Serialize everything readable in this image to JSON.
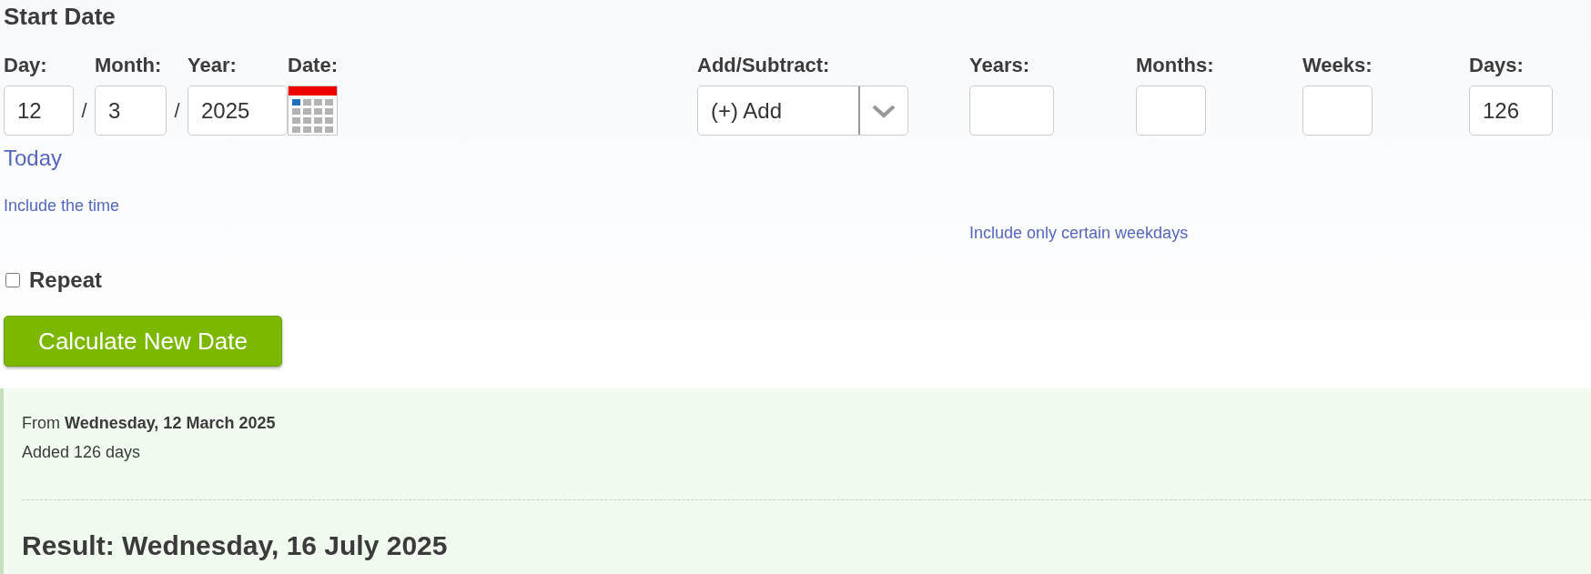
{
  "heading": "Start Date",
  "start_fields": [
    {
      "label": "Day:",
      "value": "12"
    },
    {
      "label": "Month:",
      "value": "3"
    },
    {
      "label": "Year:",
      "value": "2025"
    }
  ],
  "separators": [
    "/",
    "/"
  ],
  "date_picker": {
    "label": "Date:"
  },
  "today_link": "Today",
  "include_time_link": "Include the time",
  "operation": {
    "label": "Add/Subtract:",
    "value": "(+) Add"
  },
  "amounts": [
    {
      "label": "Years:"
    },
    {
      "label": "Months:"
    },
    {
      "label": "Weeks:"
    },
    {
      "label": "Days:",
      "value": "126"
    }
  ],
  "weekdays_link": "Include only certain weekdays",
  "repeat": {
    "label": "Repeat",
    "checked": false
  },
  "calculate_button": "Calculate New Date",
  "result": {
    "from": "From **Wednesday, 12 March 2025**",
    "added": "Added 126 days",
    "result": "Result: Wednesday, 16 July 2025"
  }
}
